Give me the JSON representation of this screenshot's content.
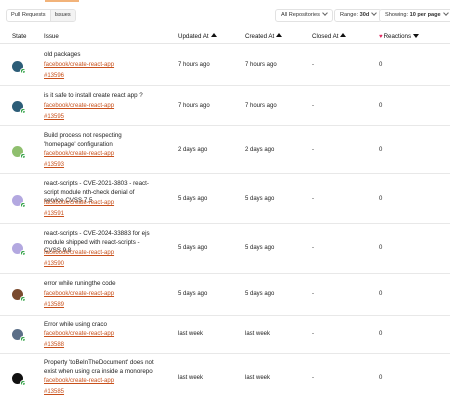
{
  "toolbar": {
    "pull_requests": "Pull Requests",
    "issues": "Issues",
    "repositories": "All Repositories",
    "range_prefix": "Range:",
    "range_value": "30d",
    "showing_prefix": "Showing:",
    "showing_value": "10 per page"
  },
  "columns": {
    "state": "State",
    "issue": "Issue",
    "updated": "Updated At",
    "created": "Created At",
    "closed": "Closed At",
    "reactions": "Reactions"
  },
  "issues": [
    {
      "title": "old packages",
      "repo": "facebook/create-react-app",
      "number": "#13596",
      "updated": "7 hours ago",
      "created": "7 hours ago",
      "closed": "-",
      "reactions": "0",
      "avatar_color": "#2c5d78"
    },
    {
      "title": "is it safe to install create react app ?",
      "repo": "facebook/create-react-app",
      "number": "#13595",
      "updated": "7 hours ago",
      "created": "7 hours ago",
      "closed": "-",
      "reactions": "0",
      "avatar_color": "#2c5d78"
    },
    {
      "title": "Build process not respecting 'homepage' configuration",
      "repo": "facebook/create-react-app",
      "number": "#13593",
      "updated": "2 days ago",
      "created": "2 days ago",
      "closed": "-",
      "reactions": "0",
      "avatar_color": "#8fbf6e"
    },
    {
      "title": "react-scripts - CVE-2021-3803 - react-script module nth-check denial of service CVSS 7.5",
      "repo": "facebook/create-react-app",
      "number": "#13591",
      "updated": "5 days ago",
      "created": "5 days ago",
      "closed": "-",
      "reactions": "0",
      "avatar_color": "#b3a8e0"
    },
    {
      "title": "react-scripts - CVE-2024-33883 for ejs module shipped with react-scripts - CVSS 9.8",
      "repo": "facebook/create-react-app",
      "number": "#13590",
      "updated": "5 days ago",
      "created": "5 days ago",
      "closed": "-",
      "reactions": "0",
      "avatar_color": "#b3a8e0"
    },
    {
      "title": "error while runingthe code",
      "repo": "facebook/create-react-app",
      "number": "#13589",
      "updated": "5 days ago",
      "created": "5 days ago",
      "closed": "-",
      "reactions": "0",
      "avatar_color": "#7a4a2e"
    },
    {
      "title": "Error while using craco",
      "repo": "facebook/create-react-app",
      "number": "#13588",
      "updated": "last week",
      "created": "last week",
      "closed": "-",
      "reactions": "0",
      "avatar_color": "#5b6e87"
    },
    {
      "title": "Property 'toBeInTheDocument' does not exist when using cra inside a monorepo",
      "repo": "facebook/create-react-app",
      "number": "#13585",
      "updated": "last week",
      "created": "last week",
      "closed": "-",
      "reactions": "0",
      "avatar_color": "#111111"
    }
  ]
}
